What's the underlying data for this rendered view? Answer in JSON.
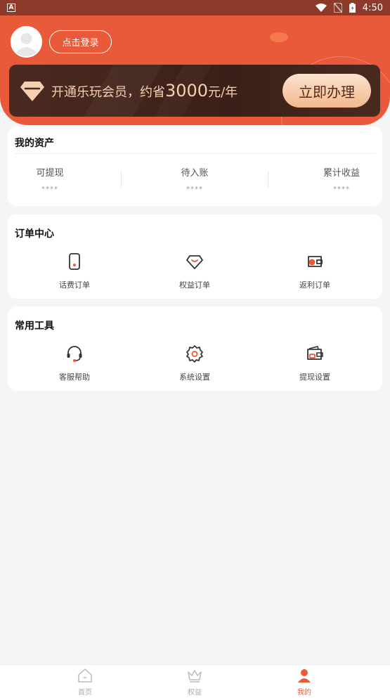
{
  "status_bar": {
    "time": "4:50",
    "app_badge": "A"
  },
  "header": {
    "login_label": "点击登录",
    "vip": {
      "text_prefix": "开通乐玩会员，约省",
      "amount": "3000",
      "text_suffix": "元/年",
      "button_label": "立即办理"
    }
  },
  "assets": {
    "title": "我的资产",
    "items": [
      {
        "label": "可提现",
        "value": "****"
      },
      {
        "label": "待入账",
        "value": "****"
      },
      {
        "label": "累计收益",
        "value": "****"
      }
    ]
  },
  "orders": {
    "title": "订单中心",
    "items": [
      {
        "label": "话费订单",
        "icon": "phone-icon"
      },
      {
        "label": "权益订单",
        "icon": "shield-heart-icon"
      },
      {
        "label": "返利订单",
        "icon": "coin-wallet-icon"
      }
    ]
  },
  "tools": {
    "title": "常用工具",
    "items": [
      {
        "label": "客服帮助",
        "icon": "headset-icon"
      },
      {
        "label": "系统设置",
        "icon": "gear-icon"
      },
      {
        "label": "提现设置",
        "icon": "wallet-icon"
      }
    ]
  },
  "tabbar": {
    "items": [
      {
        "label": "首页",
        "icon": "home-icon"
      },
      {
        "label": "权益",
        "icon": "crown-icon"
      },
      {
        "label": "我的",
        "icon": "user-icon"
      }
    ],
    "active": "我的"
  },
  "colors": {
    "brand": "#e85a3a",
    "vip_dark": "#3a2018",
    "vip_gold": "#f6cfb0"
  }
}
